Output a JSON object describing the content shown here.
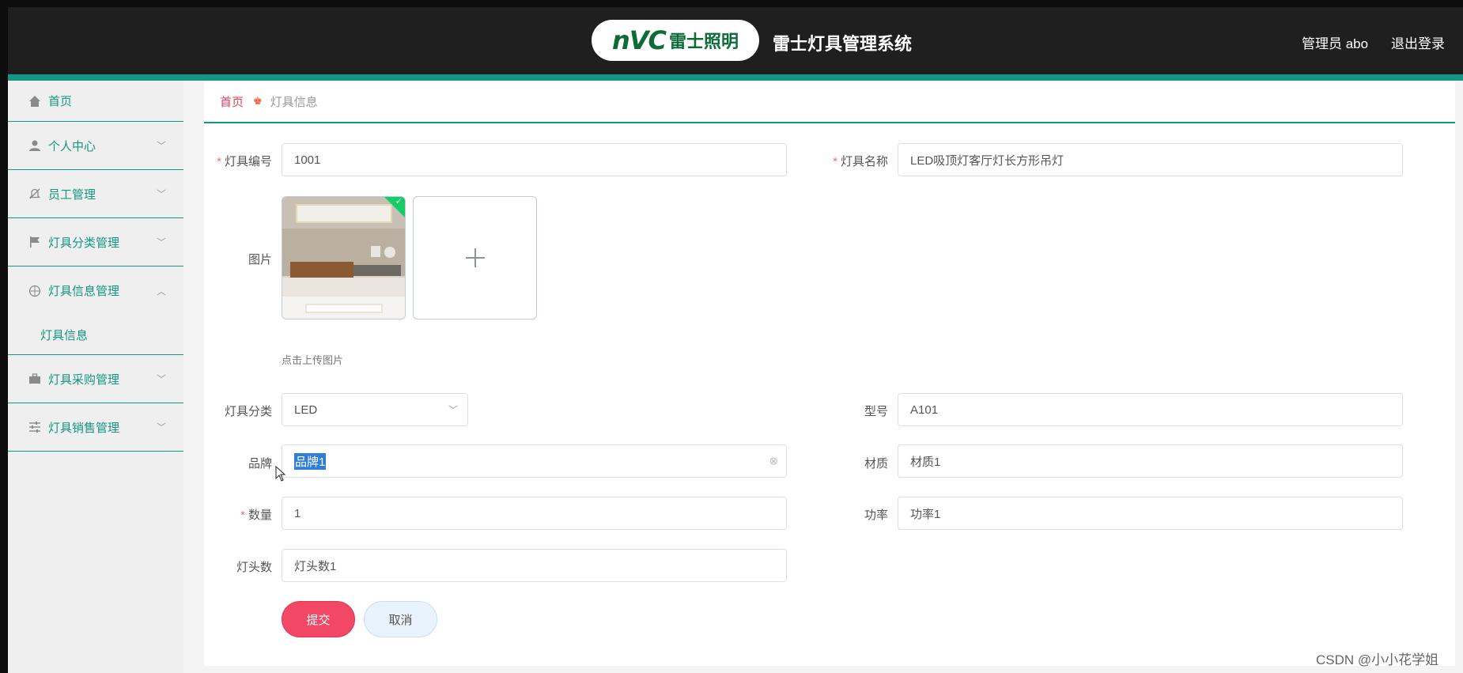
{
  "header": {
    "logo_text": "nVC",
    "logo_sub": "雷士照明",
    "title": "雷士灯具管理系统",
    "user": "管理员 abo",
    "logout": "退出登录"
  },
  "sidebar": {
    "items": [
      {
        "label": "首页",
        "icon": "home-icon"
      },
      {
        "label": "个人中心",
        "icon": "user-icon"
      },
      {
        "label": "员工管理",
        "icon": "bell-off-icon"
      },
      {
        "label": "灯具分类管理",
        "icon": "flag-icon"
      },
      {
        "label": "灯具信息管理",
        "icon": "compass-icon"
      },
      {
        "label": "灯具采购管理",
        "icon": "briefcase-icon"
      },
      {
        "label": "灯具销售管理",
        "icon": "sliders-icon"
      }
    ],
    "sub_item": "灯具信息"
  },
  "breadcrumb": {
    "home": "首页",
    "current": "灯具信息"
  },
  "form": {
    "code_label": "灯具编号",
    "code_value": "1001",
    "name_label": "灯具名称",
    "name_value": "LED吸顶灯客厅灯长方形吊灯",
    "image_label": "图片",
    "upload_tip": "点击上传图片",
    "category_label": "灯具分类",
    "category_value": "LED",
    "model_label": "型号",
    "model_value": "A101",
    "brand_label": "品牌",
    "brand_value": "品牌1",
    "material_label": "材质",
    "material_value": "材质1",
    "quantity_label": "数量",
    "quantity_value": "1",
    "power_label": "功率",
    "power_value": "功率1",
    "heads_label": "灯头数",
    "heads_value": "灯头数1",
    "submit": "提交",
    "cancel": "取消"
  },
  "watermark": "CSDN @小小花学姐",
  "colors": {
    "accent": "#149782",
    "submit": "#f24866",
    "header_bg": "#1f1f1f"
  }
}
